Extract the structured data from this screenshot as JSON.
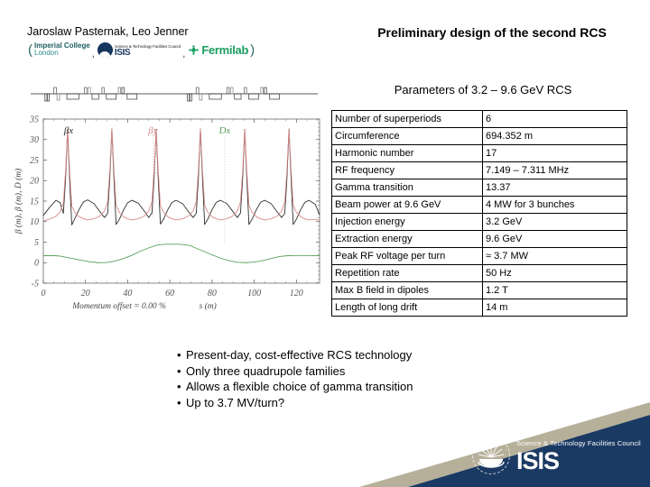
{
  "header": {
    "authors": "Jaroslaw Pasternak, Leo Jenner",
    "open_paren": "(",
    "close_paren": ")",
    "separator": ",",
    "affiliations": [
      {
        "name": "Imperial College",
        "sub": "London"
      },
      {
        "name": "ISIS",
        "sub": "Science & Technology Facilities Council"
      },
      {
        "name": "Fermilab",
        "sub": ""
      }
    ],
    "title": "Preliminary design of the second RCS"
  },
  "params": {
    "subtitle": "Parameters of 3.2 – 9.6 GeV RCS",
    "rows": [
      {
        "key": "Number of superperiods",
        "value": "6"
      },
      {
        "key": "Circumference",
        "value": "694.352 m"
      },
      {
        "key": "Harmonic number",
        "value": "17"
      },
      {
        "key": "RF frequency",
        "value": "7.149 – 7.311 MHz"
      },
      {
        "key": "Gamma transition",
        "value": "13.37"
      },
      {
        "key": "Beam power at 9.6 GeV",
        "value": "4 MW for 3 bunches"
      },
      {
        "key": "Injection energy",
        "value": "3.2 GeV"
      },
      {
        "key": "Extraction energy",
        "value": "9.6 GeV"
      },
      {
        "key": "Peak RF voltage per turn",
        "value": "≈ 3.7 MW"
      },
      {
        "key": "Repetition rate",
        "value": "50 Hz"
      },
      {
        "key": "Max B field in dipoles",
        "value": "1.2 T"
      },
      {
        "key": "Length of long drift",
        "value": "14 m"
      }
    ]
  },
  "bullets": [
    "Present-day, cost-effective RCS technology",
    "Only three quadrupole families",
    "Allows a flexible choice of gamma transition",
    "Up to 3.7 MV/turn?"
  ],
  "bullet_marker": "•",
  "footer": {
    "org_line": "Science & Technology Facilities Council",
    "org_name": "ISIS",
    "banner_color": "#1b3a63",
    "stripe_color": "#b6b09a"
  },
  "chart_data": {
    "type": "line",
    "title": "",
    "xlabel": "s (m)",
    "ylabel": "β (m), β (m), D (m)",
    "annotation": "Momentum offset = 0.00 %",
    "xlim": [
      0,
      131
    ],
    "ylim": [
      -5,
      35
    ],
    "xticks": [
      0,
      20,
      40,
      60,
      80,
      100,
      120
    ],
    "yticks": [
      -5,
      0,
      5,
      10,
      15,
      20,
      25,
      30,
      35
    ],
    "grid": false,
    "legend_position": "inside-top",
    "legend": [
      {
        "name": "βx",
        "color": "#303030"
      },
      {
        "name": "βy",
        "color": "#d98a8a"
      },
      {
        "name": "Dx",
        "color": "#5aa05a"
      }
    ],
    "series": [
      {
        "name": "βx",
        "color": "#303030",
        "x": [
          0,
          3,
          6,
          8,
          9.5,
          10.5,
          11.5,
          12.5,
          13.5,
          15,
          17,
          19,
          21,
          24,
          27,
          29,
          30.5,
          31.5,
          32.5,
          33.5,
          34.5,
          36,
          38,
          40,
          42,
          45,
          48,
          50,
          51.5,
          52.5,
          53.5,
          54.5,
          55.5,
          57,
          59,
          61,
          63,
          66,
          69,
          71,
          72.5,
          73.5,
          74.5,
          75.5,
          76.5,
          78,
          80,
          82,
          84,
          87,
          90,
          92,
          93.5,
          94.5,
          95.5,
          96.5,
          97.5,
          99,
          101,
          103,
          105,
          108,
          111,
          113,
          114.5,
          115.5,
          116.5,
          117.5,
          118.5,
          120,
          122,
          124,
          126,
          129,
          131
        ],
        "y": [
          11.5,
          13.5,
          15.2,
          14.6,
          12.0,
          20.0,
          32.5,
          20.0,
          9.2,
          10.8,
          13.0,
          14.8,
          15.3,
          14.4,
          12.3,
          11.0,
          12.0,
          20.5,
          32.6,
          20.5,
          9.3,
          10.5,
          12.8,
          14.6,
          15.2,
          14.5,
          12.5,
          11.0,
          12.1,
          20.3,
          32.5,
          20.3,
          9.4,
          10.6,
          12.9,
          14.7,
          15.2,
          14.4,
          12.3,
          11.0,
          12.0,
          20.4,
          32.6,
          20.4,
          9.3,
          10.6,
          12.9,
          14.7,
          15.2,
          14.4,
          12.4,
          11.0,
          12.1,
          20.4,
          32.5,
          20.4,
          9.3,
          10.6,
          12.9,
          14.7,
          15.2,
          14.4,
          12.3,
          11.0,
          12.0,
          20.4,
          32.6,
          20.4,
          9.3,
          10.6,
          12.9,
          14.7,
          15.2,
          14.2,
          11.6
        ]
      },
      {
        "name": "βy",
        "color": "#d98a8a",
        "x": [
          0,
          3,
          6,
          8,
          9.5,
          10.5,
          11.5,
          12.5,
          13.5,
          15,
          17,
          19,
          21,
          24,
          27,
          29,
          30.5,
          31.5,
          32.5,
          33.5,
          34.5,
          36,
          38,
          40,
          42,
          45,
          48,
          50,
          51.5,
          52.5,
          53.5,
          54.5,
          55.5,
          57,
          59,
          61,
          63,
          66,
          69,
          71,
          72.5,
          73.5,
          74.5,
          75.5,
          76.5,
          78,
          80,
          82,
          84,
          87,
          90,
          92,
          93.5,
          94.5,
          95.5,
          96.5,
          97.5,
          99,
          101,
          103,
          105,
          108,
          111,
          113,
          114.5,
          115.5,
          116.5,
          117.5,
          118.5,
          120,
          122,
          124,
          126,
          129,
          131
        ],
        "y": [
          10.2,
          10.6,
          11.3,
          12.4,
          14.5,
          22.0,
          32.4,
          22.0,
          13.8,
          12.2,
          11.2,
          10.7,
          10.4,
          10.7,
          11.4,
          12.6,
          14.8,
          22.3,
          32.5,
          22.3,
          14.0,
          12.3,
          11.2,
          10.7,
          10.4,
          10.7,
          11.4,
          12.6,
          14.8,
          22.2,
          32.4,
          22.2,
          14.0,
          12.3,
          11.2,
          10.7,
          10.4,
          10.7,
          11.4,
          12.6,
          14.8,
          22.3,
          32.5,
          22.3,
          14.0,
          12.3,
          11.2,
          10.7,
          10.4,
          10.7,
          11.4,
          12.6,
          14.8,
          22.2,
          32.4,
          22.2,
          14.0,
          12.3,
          11.2,
          10.7,
          10.4,
          10.7,
          11.4,
          12.6,
          14.8,
          22.3,
          32.5,
          22.3,
          14.0,
          12.3,
          11.2,
          10.7,
          10.4,
          10.6,
          10.3
        ]
      },
      {
        "name": "Dx",
        "color": "#5aa05a",
        "x": [
          0,
          5,
          8,
          10,
          14,
          18,
          22,
          26,
          30,
          34,
          38,
          42,
          46,
          50,
          54,
          58,
          60,
          62,
          64,
          66,
          68,
          70,
          72,
          76,
          80,
          84,
          88,
          92,
          96,
          100,
          104,
          108,
          112,
          116,
          120,
          124,
          128,
          131
        ],
        "y": [
          1.7,
          1.7,
          1.6,
          1.4,
          1.0,
          0.6,
          0.2,
          0.0,
          0.05,
          0.4,
          1.0,
          1.8,
          2.8,
          3.6,
          4.3,
          4.5,
          4.5,
          4.5,
          4.5,
          4.4,
          4.3,
          4.1,
          3.6,
          2.8,
          1.9,
          1.1,
          0.5,
          0.1,
          0.0,
          0.15,
          0.5,
          1.0,
          1.5,
          1.7,
          1.75,
          1.75,
          1.72,
          1.7
        ]
      }
    ]
  }
}
